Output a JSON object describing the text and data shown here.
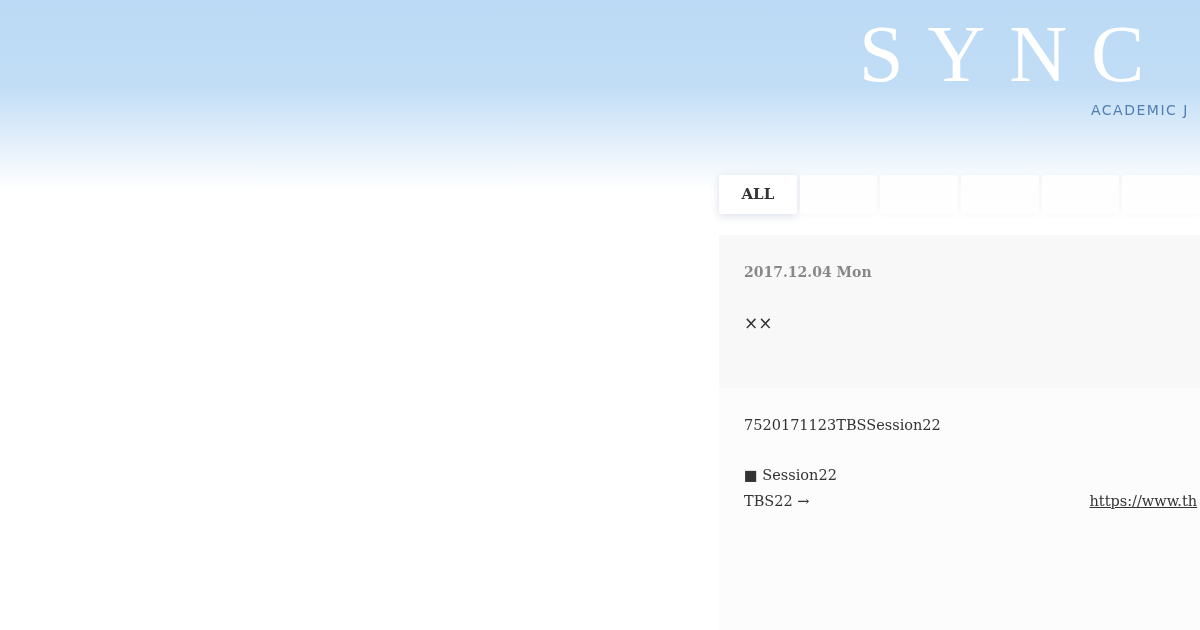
{
  "header": {
    "logo": "SYNC",
    "tagline": "ACADEMIC J"
  },
  "tabs": [
    {
      "label": "ALL",
      "selected": true
    },
    {
      "selected": false
    },
    {
      "selected": false
    },
    {
      "selected": false
    },
    {
      "selected": false
    },
    {
      "selected": false
    }
  ],
  "post": {
    "date": "2017.12.04 Mon",
    "title": "××",
    "lead": "7520171123TBSSession22",
    "heading": "■ Session22",
    "line": {
      "text": "TBS22 →",
      "link": "https://www.th"
    }
  }
}
